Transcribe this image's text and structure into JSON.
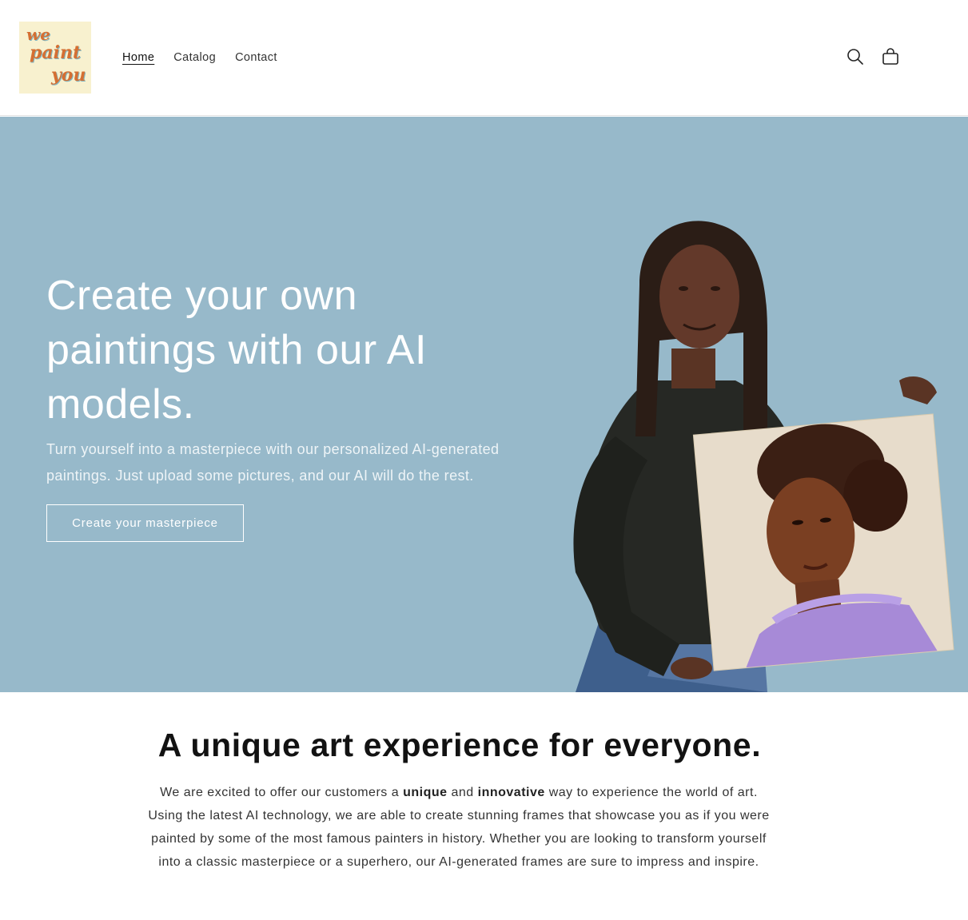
{
  "header": {
    "logo_text": [
      "we",
      "paint",
      "you"
    ],
    "nav": [
      {
        "label": "Home",
        "active": true
      },
      {
        "label": "Catalog",
        "active": false
      },
      {
        "label": "Contact",
        "active": false
      }
    ],
    "icons": {
      "search": "search-icon",
      "cart": "cart-icon"
    }
  },
  "hero": {
    "title": "Create your own paintings with our AI models.",
    "subtitle": "Turn yourself into a masterpiece with our personalized AI-generated paintings. Just upload some pictures, and our AI will do the rest.",
    "cta_label": "Create your masterpiece",
    "background_color": "#97b9ca"
  },
  "intro": {
    "title_prefix": "A",
    "title_bold": "unique",
    "title_suffix": "art experience for everyone.",
    "p_part1": "We are excited to offer our customers a",
    "p_bold1": "unique",
    "p_part2": "and",
    "p_bold2": "innovative",
    "p_part3": "way to experience the world of art. Using the latest AI technology, we are able to create stunning frames that showcase you as if you were painted by some of the most famous painters in history. Whether you are looking to transform yourself into a classic masterpiece or a superhero, our AI-generated frames are sure to impress and inspire."
  },
  "colors": {
    "logo_bg": "#f8f1cf",
    "logo_text": "#d56f32",
    "text_dark": "#121212"
  }
}
